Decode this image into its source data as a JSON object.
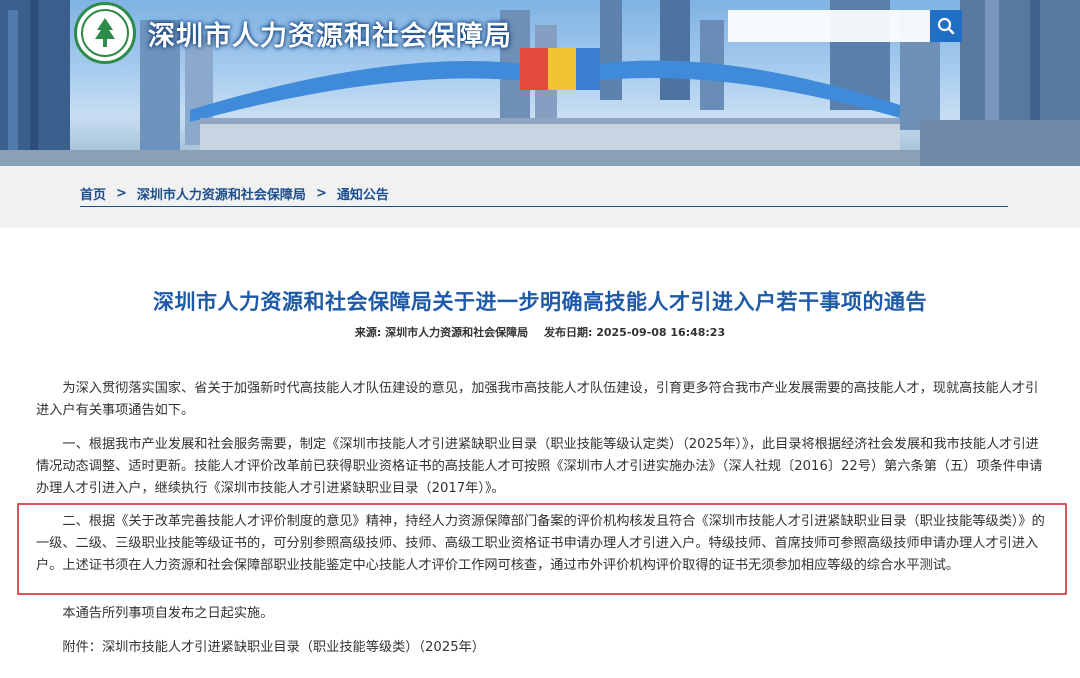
{
  "header": {
    "site_title": "深圳市人力资源和社会保障局",
    "search_placeholder": "",
    "logo_icon": "shenzhen-hr-logo-icon",
    "search_icon": "search-icon"
  },
  "breadcrumb": {
    "items": [
      "首页",
      "深圳市人力资源和社会保障局",
      "通知公告"
    ],
    "separator": ">"
  },
  "article": {
    "title": "深圳市人力资源和社会保障局关于进一步明确高技能人才引进入户若干事项的通告",
    "source_label": "来源:",
    "source_value": "深圳市人力资源和社会保障局",
    "date_label": "发布日期:",
    "date_value": "2025-09-08 16:48:23",
    "paragraphs": [
      "为深入贯彻落实国家、省关于加强新时代高技能人才队伍建设的意见，加强我市高技能人才队伍建设，引育更多符合我市产业发展需要的高技能人才，现就高技能人才引进入户有关事项通告如下。",
      "一、根据我市产业发展和社会服务需要，制定《深圳市技能人才引进紧缺职业目录（职业技能等级认定类）（2025年）》，此目录将根据经济社会发展和我市技能人才引进情况动态调整、适时更新。技能人才评价改革前已获得职业资格证书的高技能人才可按照《深圳市人才引进实施办法》（深人社规〔2016〕22号）第六条第（五）项条件申请办理人才引进入户，继续执行《深圳市技能人才引进紧缺职业目录（2017年）》。",
      "二、根据《关于改革完善技能人才评价制度的意见》精神，持经人力资源保障部门备案的评价机构核发且符合《深圳市技能人才引进紧缺职业目录（职业技能等级类）》的一级、二级、三级职业技能等级证书的，可分别参照高级技师、技师、高级工职业资格证书申请办理人才引进入户。特级技师、首席技师可参照高级技师申请办理人才引进入户。上述证书须在人力资源和社会保障部职业技能鉴定中心技能人才评价工作网可核查，通过市外评价机构评价取得的证书无须参加相应等级的综合水平测试。",
      "本通告所列事项自发布之日起实施。",
      "附件：深圳市技能人才引进紧缺职业目录（职业技能等级类）（2025年）"
    ]
  },
  "colors": {
    "title_blue": "#1e5aa6",
    "breadcrumb_blue": "#1d4f8c",
    "highlight_red": "#e0505a",
    "search_button": "#1f6fc5"
  }
}
